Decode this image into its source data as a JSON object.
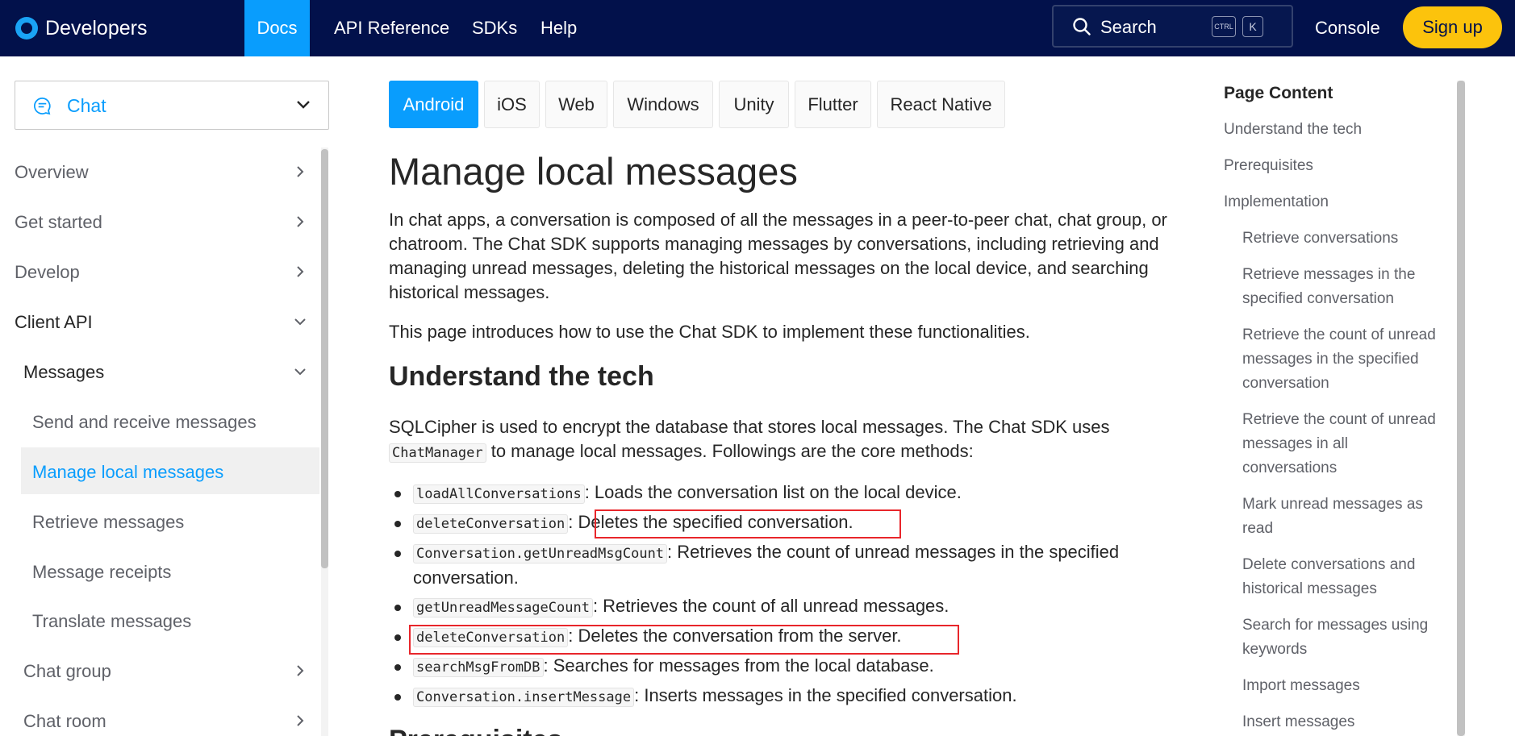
{
  "topnav": {
    "brand": "Developers",
    "links": [
      "Docs",
      "API Reference",
      "SDKs",
      "Help"
    ],
    "search_label": "Search",
    "kbd_ctrl": "CTRL",
    "kbd_k": "K",
    "console": "Console",
    "signup": "Sign up"
  },
  "sidebar": {
    "product": "Chat",
    "items": [
      "Overview",
      "Get started",
      "Develop",
      "Client API",
      "Messages",
      "Send and receive messages",
      "Manage local messages",
      "Retrieve messages",
      "Message receipts",
      "Translate messages",
      "Chat group",
      "Chat room"
    ]
  },
  "tabs": [
    "Android",
    "iOS",
    "Web",
    "Windows",
    "Unity",
    "Flutter",
    "React Native"
  ],
  "content": {
    "title": "Manage local messages",
    "intro_lines": [
      "In chat apps, a conversation is composed of all the messages in a peer-to-peer chat, chat group, or",
      "chatroom. The Chat SDK supports managing messages by conversations, including retrieving and",
      "managing unread messages, deleting the historical messages on the local device, and searching",
      "historical messages."
    ],
    "intro2": "This page introduces how to use the Chat SDK to implement these functionalities.",
    "h2": "Understand the tech",
    "tech_line1": "SQLCipher is used to encrypt the database that stores local messages. The Chat SDK uses",
    "tech_code": "ChatManager",
    "tech_line2_rest": " to manage local messages. Followings are the core methods:",
    "bullets": [
      {
        "code": "loadAllConversations",
        "text": ": Loads the conversation list on the local device."
      },
      {
        "code": "deleteConversation",
        "text": ": Deletes the specified conversation."
      },
      {
        "code": "Conversation.getUnreadMsgCount",
        "text": ": Retrieves the count of unread messages in the specified",
        "text2": "conversation."
      },
      {
        "code": "getUnreadMessageCount",
        "text": ": Retrieves the count of all unread messages."
      },
      {
        "code": "deleteConversation",
        "text": ": Deletes the conversation from the server."
      },
      {
        "code": "searchMsgFromDB",
        "text": ": Searches for messages from the local database."
      },
      {
        "code": "Conversation.insertMessage",
        "text": ": Inserts messages in the specified conversation."
      }
    ],
    "next_heading": "Prerequisites"
  },
  "toc": {
    "title": "Page Content",
    "items": [
      "Understand the tech",
      "Prerequisites",
      "Implementation",
      "Retrieve conversations",
      "Retrieve messages in the",
      "specified conversation",
      "Retrieve the count of unread",
      "messages in the specified",
      "conversation",
      "Retrieve the count of unread",
      "messages in all",
      "conversations",
      "Mark unread messages as",
      "read",
      "Delete conversations and",
      "historical messages",
      "Search for messages using",
      "keywords",
      "Import messages",
      "Insert messages"
    ]
  },
  "colors": {
    "nav_bg": "#02114b",
    "accent": "#099dfd",
    "signup": "#fcc30c",
    "highlight_box": "#e8262b"
  }
}
